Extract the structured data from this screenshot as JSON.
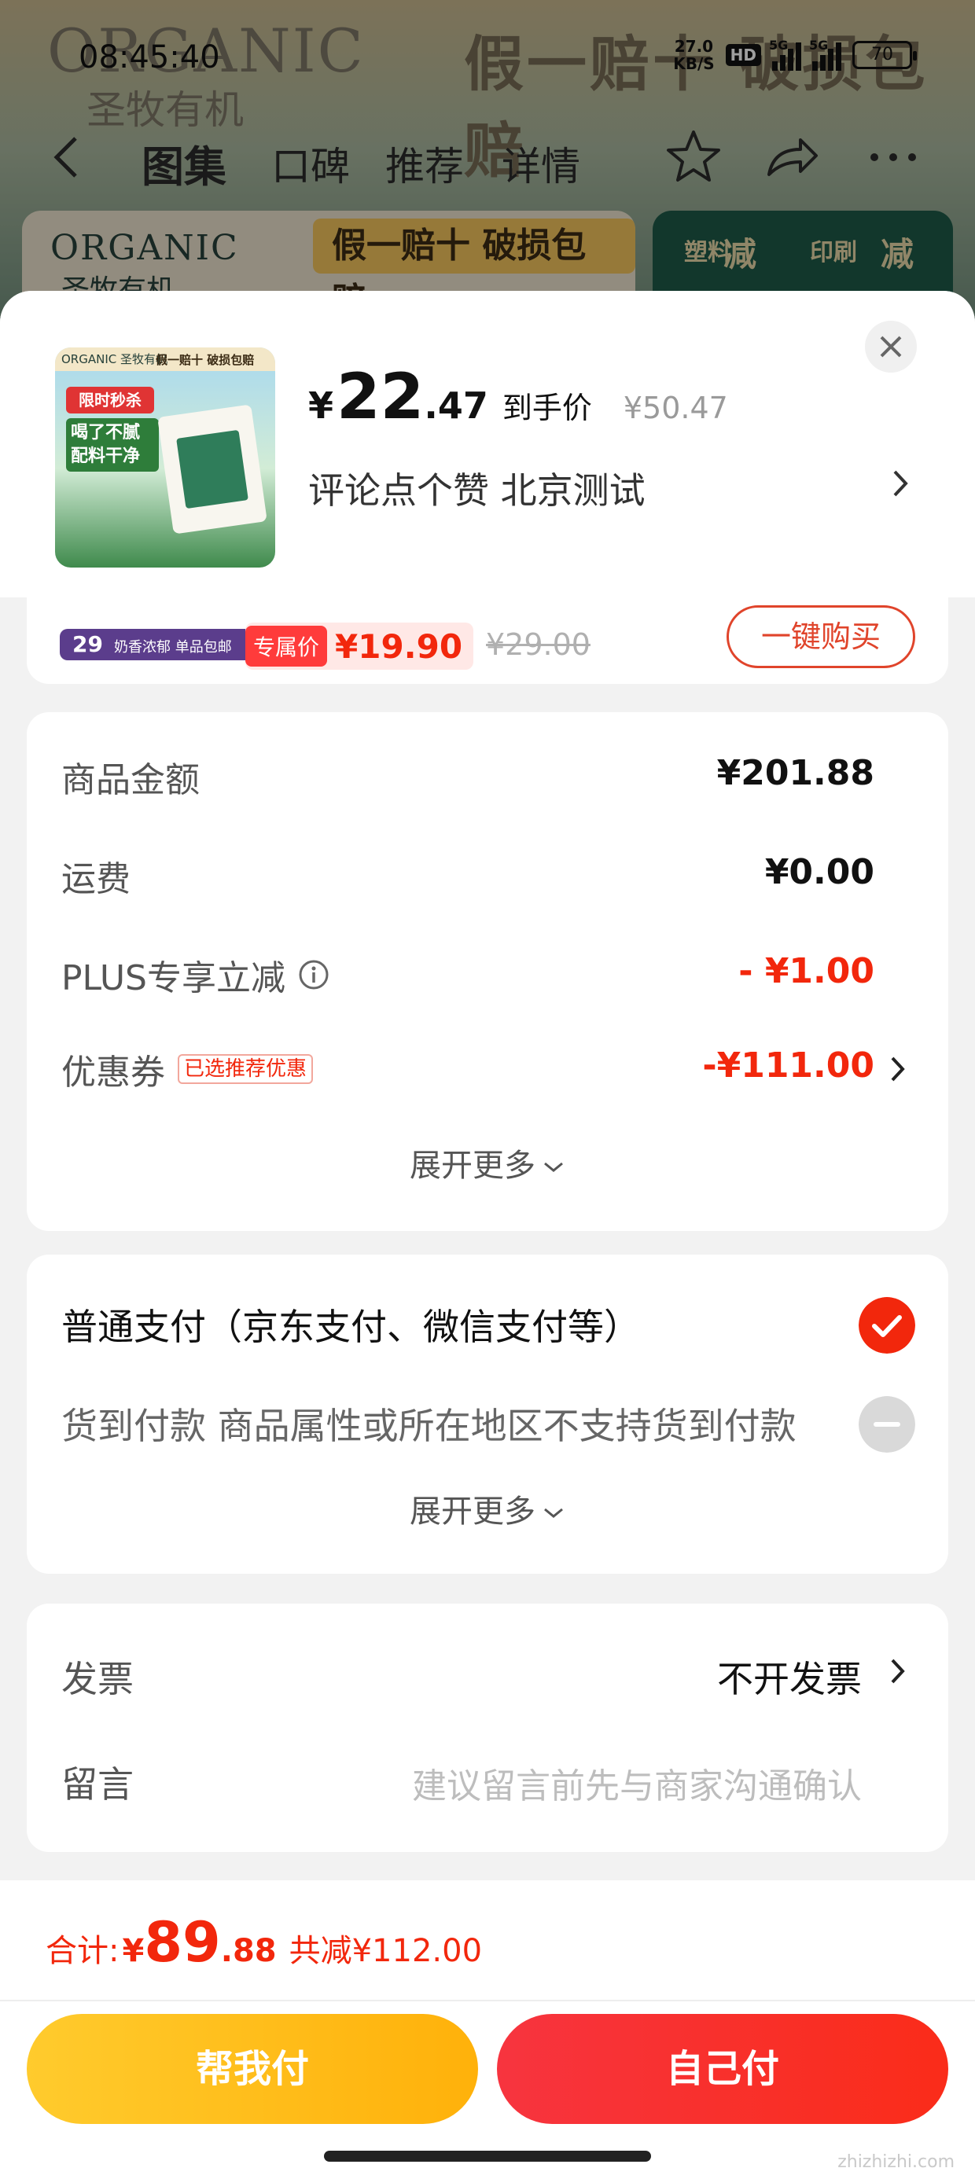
{
  "status_bar": {
    "time": "08:45:40",
    "net_speed_value": "27.0",
    "net_speed_unit": "KB/S",
    "hd_badge": "HD",
    "signal_1_label": "5G",
    "signal_2_label": "5G",
    "battery": "70"
  },
  "background_page": {
    "watermark_brand": "ORGANIC",
    "watermark_brand_cn": "圣牧有机",
    "watermark_slogan": "假一赔十 破损包赔",
    "tabs": [
      "图集",
      "口碑",
      "推荐",
      "详情"
    ],
    "active_tab": 0,
    "banner_brand": "ORGANIC",
    "banner_brand_cn": "圣牧有机",
    "banner_slogan": "假一赔十 破损包赔"
  },
  "product": {
    "thumb_brand": "ORGANIC 圣牧有机",
    "thumb_slogan": "假一赔十 破损包赔",
    "thumb_sale": "限时秒杀",
    "thumb_title": "喝了不腻 配料干净",
    "price_currency": "¥",
    "price_integer": "22",
    "price_decimal": ".47",
    "price_label": "到手价",
    "original_price": "¥50.47",
    "spec_text": "评论点个赞  北京测试"
  },
  "upsell": {
    "tag_text": "29",
    "tag_sub": "奶香浓郁 单品包邮",
    "exclusive_tag": "专属价",
    "exclusive_price": "¥19.90",
    "strike_price": "¥29.00",
    "button_label": "一键购买"
  },
  "amounts": {
    "rows": [
      {
        "label": "商品金额",
        "value": "¥201.88",
        "red": false
      },
      {
        "label": "运费",
        "value": "¥0.00",
        "red": false
      },
      {
        "label": "PLUS专享立减",
        "value": "- ¥1.00",
        "red": true
      },
      {
        "label": "优惠券",
        "badge": "已选推荐优惠",
        "value": "-¥111.00",
        "red": true
      }
    ],
    "expand_label": "展开更多"
  },
  "payment": {
    "options": [
      {
        "label": "普通支付（京东支付、微信支付等）",
        "selected": true
      },
      {
        "label": "货到付款 商品属性或所在地区不支持货到付款",
        "selected": false
      }
    ],
    "expand_label": "展开更多"
  },
  "invoice": {
    "label": "发票",
    "value": "不开发票",
    "message_label": "留言",
    "message_placeholder": "建议留言前先与商家沟通确认"
  },
  "footer": {
    "total_label": "合计:",
    "total_currency": "¥",
    "total_integer": "89",
    "total_decimal": ".88",
    "total_saved": "共减¥112.00",
    "helper_pay_label": "帮我付",
    "self_pay_label": "自己付",
    "corner_watermark": "zhizhizhi.com"
  },
  "colors": {
    "accent_red": "#f2270c",
    "helper_yellow": "#ffb10a",
    "self_red": "#fa2c19"
  },
  "icons": [
    "back-icon",
    "star-icon",
    "share-icon",
    "more-icon",
    "close-icon",
    "chevron-right-icon",
    "info-icon",
    "chevron-down-icon",
    "check-icon",
    "disabled-icon"
  ]
}
